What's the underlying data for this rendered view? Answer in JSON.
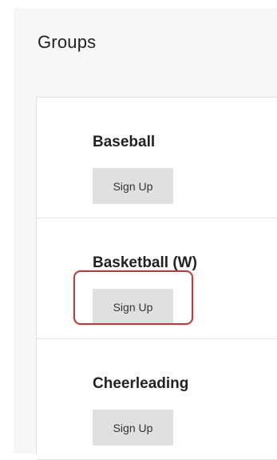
{
  "page": {
    "title": "Groups"
  },
  "groups": [
    {
      "name": "Baseball",
      "button_label": "Sign Up"
    },
    {
      "name": "Basketball (W)",
      "button_label": "Sign Up"
    },
    {
      "name": "Cheerleading",
      "button_label": "Sign Up"
    }
  ],
  "colors": {
    "highlight": "#a94442",
    "button_bg": "#e0e0e0",
    "panel_bg": "#f7f7f7"
  }
}
